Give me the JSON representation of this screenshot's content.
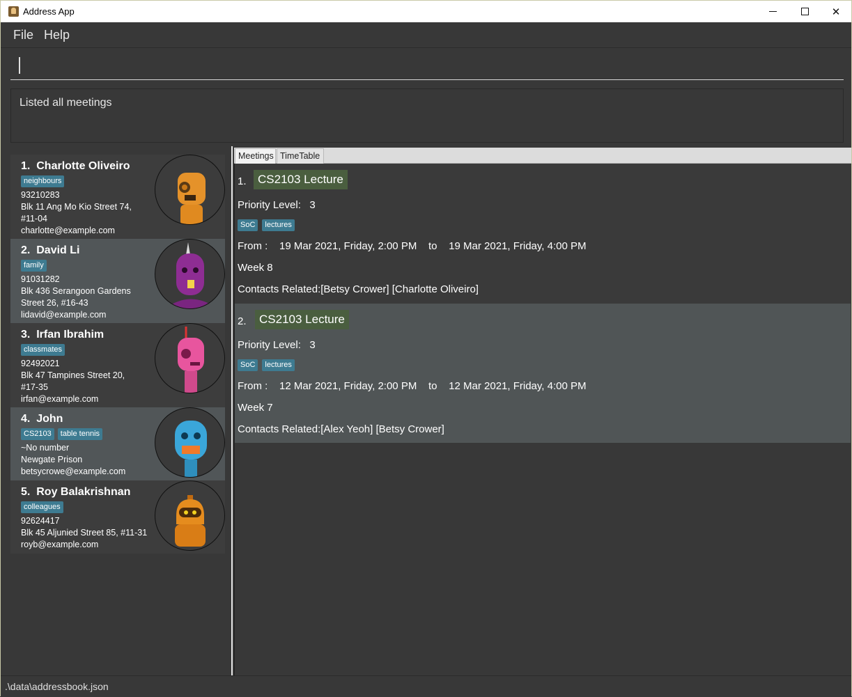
{
  "window": {
    "title": "Address App"
  },
  "menu": {
    "file": "File",
    "help": "Help"
  },
  "command": {
    "value": "",
    "placeholder": ""
  },
  "result": {
    "text": "Listed all meetings"
  },
  "persons": [
    {
      "index": "1.",
      "name": "Charlotte Oliveiro",
      "tags": [
        "neighbours"
      ],
      "phone": "93210283",
      "address1": "Blk 11 Ang Mo Kio Street 74,",
      "address2": "#11-04",
      "email": "charlotte@example.com"
    },
    {
      "index": "2.",
      "name": "David Li",
      "tags": [
        "family"
      ],
      "phone": "91031282",
      "address1": "Blk 436 Serangoon Gardens",
      "address2": "Street 26, #16-43",
      "email": "lidavid@example.com"
    },
    {
      "index": "3.",
      "name": "Irfan Ibrahim",
      "tags": [
        "classmates"
      ],
      "phone": "92492021",
      "address1": "Blk 47 Tampines Street 20,",
      "address2": "#17-35",
      "email": "irfan@example.com"
    },
    {
      "index": "4.",
      "name": "John",
      "tags": [
        "CS2103",
        "table tennis"
      ],
      "phone": "~No number",
      "address1": "Newgate Prison",
      "address2": "",
      "email": "betsycrowe@example.com"
    },
    {
      "index": "5.",
      "name": "Roy Balakrishnan",
      "tags": [
        "colleagues"
      ],
      "phone": "92624417",
      "address1": "Blk 45 Aljunied Street 85, #11-31",
      "address2": "",
      "email": "royb@example.com"
    }
  ],
  "tabs": {
    "meetings": "Meetings",
    "timetable": "TimeTable"
  },
  "meetings": [
    {
      "index": "1.",
      "title": "CS2103 Lecture",
      "priority": "Priority Level:   3",
      "tags": [
        "SoC",
        "lectures"
      ],
      "time": "From :    19 Mar 2021, Friday, 2:00 PM    to    19 Mar 2021, Friday, 4:00 PM",
      "week": "Week 8",
      "contacts": "Contacts Related:[Betsy Crower] [Charlotte Oliveiro]"
    },
    {
      "index": "2.",
      "title": "CS2103 Lecture",
      "priority": "Priority Level:   3",
      "tags": [
        "SoC",
        "lectures"
      ],
      "time": "From :    12 Mar 2021, Friday, 2:00 PM    to    12 Mar 2021, Friday, 4:00 PM",
      "week": "Week 7",
      "contacts": "Contacts Related:[Alex Yeoh] [Betsy Crower]"
    }
  ],
  "status": {
    "path": ".\\data\\addressbook.json"
  }
}
